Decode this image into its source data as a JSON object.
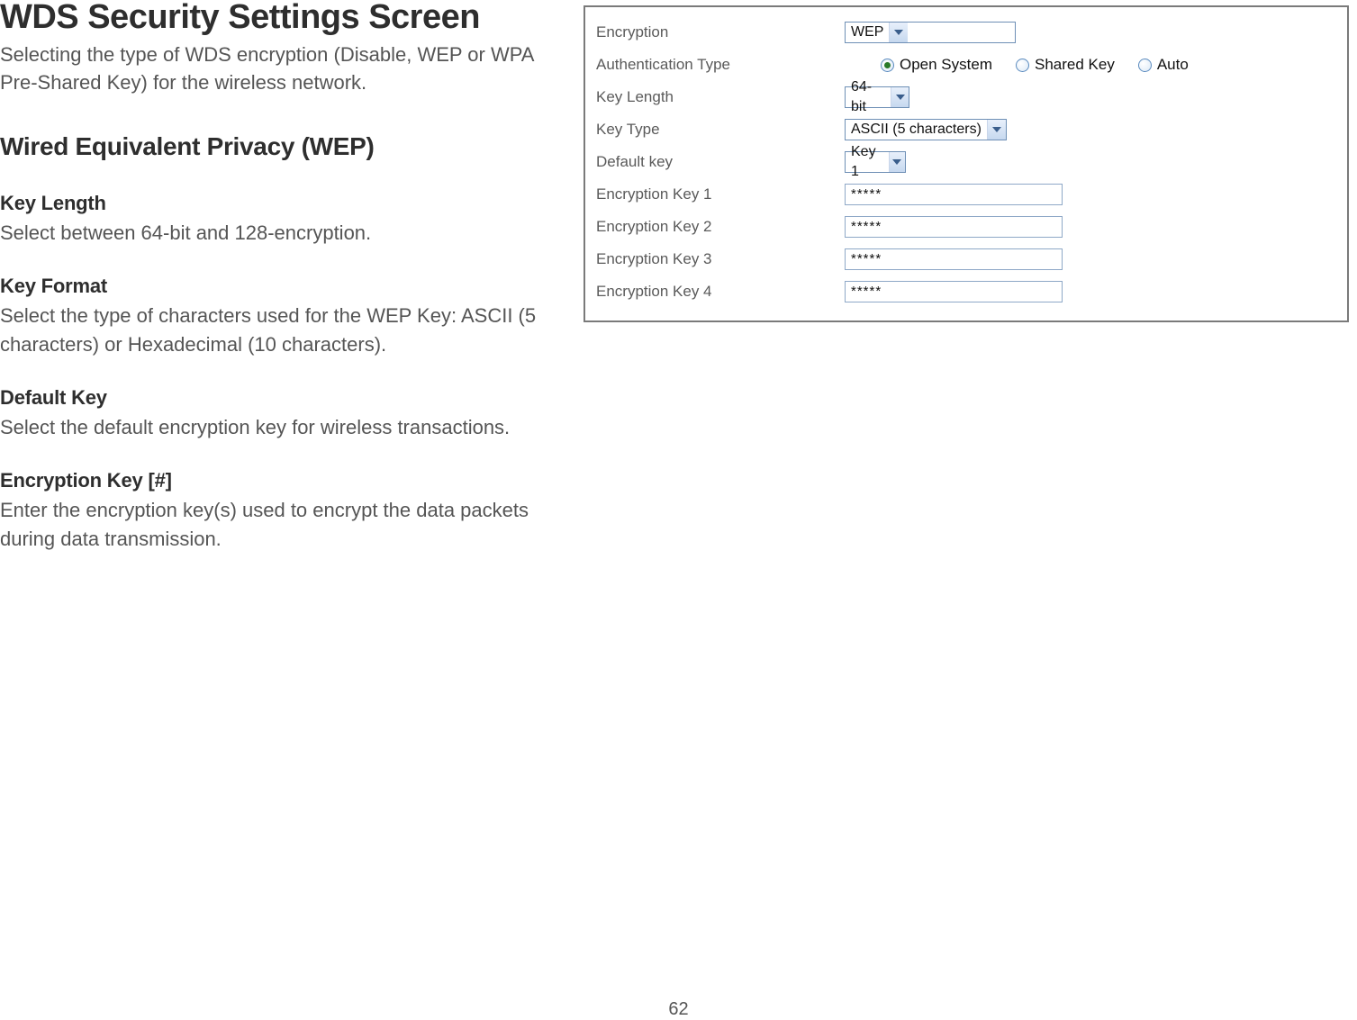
{
  "page": {
    "title": "WDS Security Settings Screen",
    "intro": "Selecting the type of WDS encryption (Disable, WEP or WPA Pre-Shared Key) for the wireless network.",
    "section_title": "Wired Equivalent Privacy (WEP)",
    "fields": [
      {
        "title": "Key Length",
        "desc": "Select between 64-bit and 128-encryption."
      },
      {
        "title": "Key Format",
        "desc": "Select the type of characters used for the WEP Key: ASCII (5 characters) or Hexadecimal (10 characters)."
      },
      {
        "title": "Default Key",
        "desc": "Select the default encryption key for wireless transactions."
      },
      {
        "title": "Encryption Key [#]",
        "desc": "Enter the encryption key(s) used to encrypt the data packets during data transmission."
      }
    ],
    "number": "62"
  },
  "panel": {
    "rows": {
      "encryption": {
        "label": "Encryption",
        "value": "WEP"
      },
      "auth": {
        "label": "Authentication Type",
        "options": [
          "Open System",
          "Shared Key",
          "Auto"
        ],
        "selected": "Open System"
      },
      "key_length": {
        "label": "Key Length",
        "value": "64-bit"
      },
      "key_type": {
        "label": "Key Type",
        "value": "ASCII (5 characters)"
      },
      "default_key": {
        "label": "Default key",
        "value": "Key 1"
      },
      "keys": [
        {
          "label": "Encryption Key 1",
          "value": "*****"
        },
        {
          "label": "Encryption Key 2",
          "value": "*****"
        },
        {
          "label": "Encryption Key 3",
          "value": "*****"
        },
        {
          "label": "Encryption Key 4",
          "value": "*****"
        }
      ]
    }
  }
}
